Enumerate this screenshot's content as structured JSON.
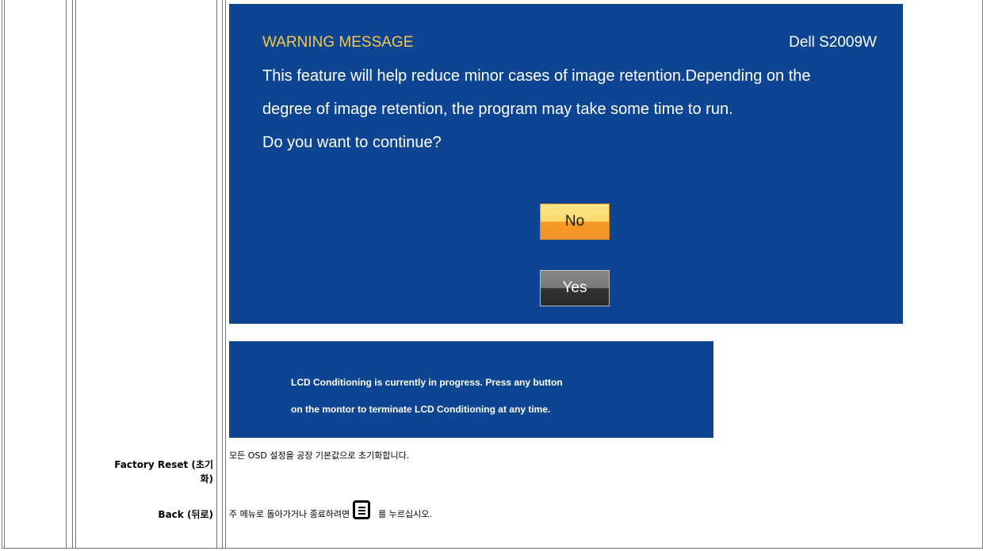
{
  "dialog": {
    "title": "WARNING MESSAGE",
    "model": "Dell S2009W",
    "line1": "This feature will help reduce minor cases of image retention.Depending on the",
    "line2": "degree of image retention, the program may take some time to run.",
    "line3": "Do you want to continue?",
    "no_label": "No",
    "yes_label": "Yes"
  },
  "progress": {
    "line1": "LCD Conditioning is currently in progress. Press any button",
    "line2": "on the montor to terminate LCD Conditioning at any time."
  },
  "factory_reset": {
    "label_line1": "Factory Reset (초기",
    "label_line2": "화)",
    "description": "모든 OSD 설정을 공장 기본값으로 초기화합니다."
  },
  "back": {
    "label": "Back (뒤로)",
    "description_before": "주 메뉴로 돌아가거나 종료하려면",
    "description_after": "를 누르십시오."
  },
  "colors": {
    "panel_blue": "#0e4592",
    "warning_yellow": "#f5c84a"
  },
  "icons": [
    "menu-button-icon"
  ]
}
